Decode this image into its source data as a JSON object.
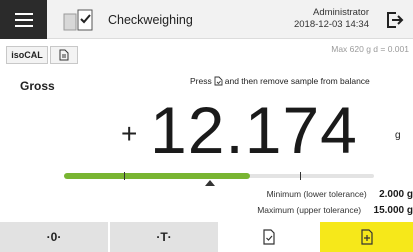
{
  "header": {
    "app_title": "Checkweighing",
    "user": "Administrator",
    "datetime": "2018-12-03   14:34"
  },
  "toolbar": {
    "iso_label": "isoCAL",
    "max_info": "Max 620 g   d = 0.001"
  },
  "main": {
    "mode_label": "Gross",
    "instruction_prefix": "Press",
    "instruction_suffix": "and then remove sample from balance",
    "sign": "+",
    "weight": "12.174",
    "unit": "g"
  },
  "tolerance": {
    "fill_fraction": 0.6,
    "min_label": "Minimum (lower tolerance)",
    "min_value": "2.000 g",
    "max_label": "Maximum (upper tolerance)",
    "max_value": "15.000 g"
  },
  "bottom": {
    "zero_label": "·0·",
    "tare_label": "·T·"
  },
  "colors": {
    "accent_yellow": "#f6e81a",
    "bar_green": "#79b532",
    "menu_dark": "#2b2b2b"
  }
}
